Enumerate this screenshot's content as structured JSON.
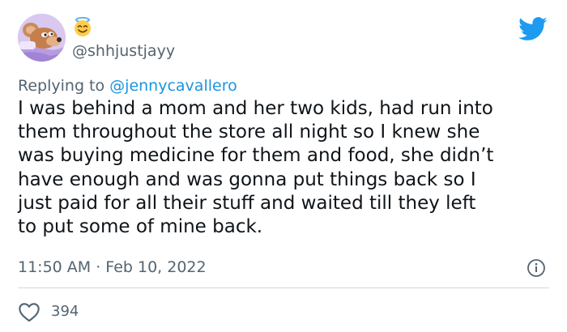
{
  "tweet": {
    "name_emoji": "😇",
    "handle": "@shhjustjayy",
    "replying_prefix": "Replying to",
    "replying_to": "@jennycavallero",
    "text_lines": [
      "I was behind a mom and her two kids, had run into",
      "them throughout the store all night so I knew she",
      "was buying medicine for them and food, she didn’t",
      "have enough and was gonna put things back so I",
      "just paid for all their stuff and waited till they left",
      "to put some of mine back."
    ],
    "timestamp": "11:50 AM · Feb 10, 2022",
    "likes": "394"
  },
  "icons": {
    "avatar": "avatar-cartoon-mouse",
    "emoji": "smiling-face-with-halo-icon",
    "logo": "twitter-bird-icon",
    "info": "info-icon",
    "like": "heart-icon"
  },
  "colors": {
    "twitter_blue": "#1d9bf0",
    "link": "#1b95e0",
    "secondary_text": "#536471",
    "primary_text": "#0f1419",
    "divider": "#cfd9de"
  }
}
